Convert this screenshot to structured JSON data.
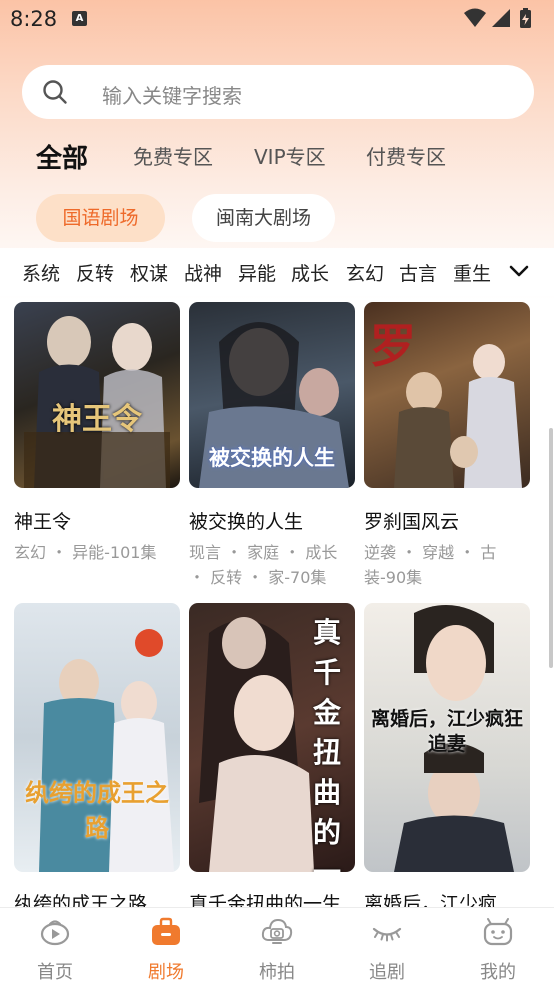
{
  "status_bar": {
    "time": "8:28",
    "notification_letter": "A"
  },
  "search": {
    "placeholder": "输入关键字搜索"
  },
  "tabs": [
    {
      "label": "全部",
      "active": true
    },
    {
      "label": "免费专区",
      "active": false
    },
    {
      "label": "VIP专区",
      "active": false
    },
    {
      "label": "付费专区",
      "active": false
    }
  ],
  "theaters": [
    {
      "label": "国语剧场",
      "active": true
    },
    {
      "label": "闽南大剧场",
      "active": false
    }
  ],
  "genres": [
    "系统",
    "反转",
    "权谋",
    "战神",
    "异能",
    "成长",
    "玄幻",
    "古言",
    "重生"
  ],
  "dramas": [
    {
      "title": "神王令",
      "meta": "玄幻 ・ 异能-101集",
      "poster_text": "神王令"
    },
    {
      "title": "被交换的人生",
      "meta": "现言 ・ 家庭 ・ 成长 ・ 反转 ・ 家-70集",
      "poster_text": "被交换的人生"
    },
    {
      "title": "罗刹国风云",
      "meta": "逆袭 ・ 穿越 ・ 古装-90集",
      "poster_text": ""
    },
    {
      "title": "纨绔的成王之路",
      "meta": "",
      "poster_text": "纨绔的成王之路"
    },
    {
      "title": "真千金扭曲的一生",
      "meta": "",
      "poster_text": "真千金扭曲的一生"
    },
    {
      "title": "离婚后，江少疯…",
      "meta": "",
      "poster_text": "离婚后，江少疯狂追妻"
    }
  ],
  "bottom_nav": [
    {
      "label": "首页",
      "icon": "play-cloud-icon",
      "active": false
    },
    {
      "label": "剧场",
      "icon": "briefcase-icon",
      "active": true
    },
    {
      "label": "柿拍",
      "icon": "camera-cloud-icon",
      "active": false
    },
    {
      "label": "追剧",
      "icon": "eye-lashes-icon",
      "active": false
    },
    {
      "label": "我的",
      "icon": "robot-face-icon",
      "active": false
    }
  ],
  "colors": {
    "accent": "#f07a2e",
    "chip_active_bg": "#fde0c8",
    "header_gradient_top": "#fbc3a6"
  }
}
